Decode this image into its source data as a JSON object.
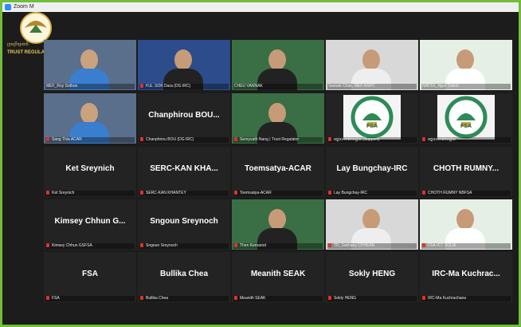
{
  "window": {
    "title": "Zoom M"
  },
  "brand": {
    "logo_text": "ក្រុមប្រឹក្សាជាតិ",
    "subtitle": "TRUST REGULATOR"
  },
  "tiles": [
    {
      "kind": "video",
      "name": "MEF_Roy Sothon",
      "label": "MEF_Roy Sothon",
      "muted": false
    },
    {
      "kind": "video",
      "name": "H.E. SOK Dara",
      "label": "H.E. SOK Dara (DG IRC)",
      "muted": true
    },
    {
      "kind": "video",
      "name": "CHEU VANNAK",
      "label": "CHEU VANNAK",
      "muted": false
    },
    {
      "kind": "video",
      "name": "Vannak Chan",
      "label": "Vannak Chan, MEF-NSPC",
      "muted": false
    },
    {
      "kind": "video",
      "name": "NBFSX Ngor Dalin",
      "label": "NBFSX_Ngor Dalinh",
      "muted": false
    },
    {
      "kind": "video",
      "name": "Sang Thia ACAR",
      "label": "Sang Thia ACAR",
      "muted": true
    },
    {
      "kind": "name",
      "name": "Chanphirou BOU...",
      "label": "Chanphirou BOU (DG IRC)",
      "muted": true
    },
    {
      "kind": "video",
      "name": "Sereyvath Nang",
      "label": "Sereyvath Nang | Trust Regulator",
      "muted": true
    },
    {
      "kind": "logo",
      "name": "FSA",
      "label": "អគ្គលេខាធិការដ្ឋាន (Support)",
      "muted": true
    },
    {
      "kind": "logo",
      "name": "FSA",
      "label": "អគ្គលេខាធិការដ្ឋាន",
      "muted": true
    },
    {
      "kind": "name",
      "name": "Ket Sreynich",
      "label": "Ket Sreynich",
      "muted": true
    },
    {
      "kind": "name",
      "name": "SERC-KAN KHA...",
      "label": "SERC-KAN KHANTEY",
      "muted": true
    },
    {
      "kind": "name",
      "name": "Toemsatya-ACAR",
      "label": "Toemsatya-ACAR",
      "muted": true
    },
    {
      "kind": "name",
      "name": "Lay Bungchay-IRC",
      "label": "Lay Bungchay-IRC",
      "muted": true
    },
    {
      "kind": "name",
      "name": "CHOTH RUMNY...",
      "label": "CHOTH RUMNY NBFSA",
      "muted": true
    },
    {
      "kind": "name",
      "name": "Kimsey Chhun G...",
      "label": "Kimsey Chhun GSFSA",
      "muted": true
    },
    {
      "kind": "name",
      "name": "Sngoun Sreynoch",
      "label": "Sngoun Sreynoch",
      "muted": true
    },
    {
      "kind": "video",
      "name": "Then Kemarod",
      "label": "Then Kemarod",
      "muted": true
    },
    {
      "kind": "video",
      "name": "TR Sokhany",
      "label": "TR_Sokhany CHHEAN",
      "muted": true
    },
    {
      "kind": "video",
      "name": "FSA",
      "label": "FSA-ICT SOLIA",
      "muted": true
    },
    {
      "kind": "name",
      "name": "FSA",
      "label": "FSA",
      "muted": true
    },
    {
      "kind": "name",
      "name": "Bullika Chea",
      "label": "Bullika Chea",
      "muted": true
    },
    {
      "kind": "name",
      "name": "Meanith SEAK",
      "label": "Meanith SEAK",
      "muted": true
    },
    {
      "kind": "name",
      "name": "Sokly HENG",
      "label": "Sokly HENG",
      "muted": true
    },
    {
      "kind": "name",
      "name": "IRC-Ma Kuchrac...",
      "label": "IRC-Ma Kuchrachana",
      "muted": true
    }
  ],
  "colors": {
    "active_border": "#c9d84b",
    "mic_muted": "#e0322b",
    "tile_bg": "#232323"
  }
}
